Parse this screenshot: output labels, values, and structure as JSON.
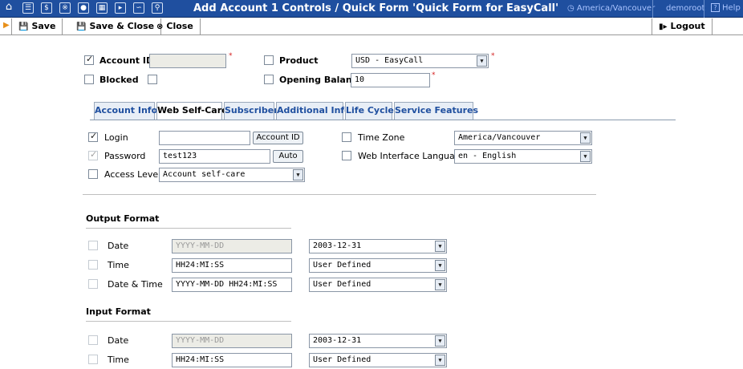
{
  "titlebar": {
    "icons": [
      "home-icon",
      "list-icon",
      "dollar-icon",
      "users-icon",
      "accounts-icon",
      "customers-icon",
      "forward-icon",
      "statistics-icon",
      "search-icon"
    ],
    "title": "Add Account 1 Controls / Quick Form 'Quick Form for EasyCall'",
    "timezone": "America/Vancouver",
    "user": "demoroot",
    "help": "Help"
  },
  "toolbar": {
    "save": "Save",
    "save_close": "Save & Close",
    "close": "Close",
    "logout": "Logout"
  },
  "header_fields": {
    "account_id": {
      "label": "Account ID",
      "checked": true,
      "value": ""
    },
    "blocked": {
      "label": "Blocked",
      "checked": false
    },
    "product": {
      "label": "Product",
      "checked": false,
      "value": "USD - EasyCall"
    },
    "opening_balance": {
      "label": "Opening Balance",
      "checked": false,
      "value": "10"
    }
  },
  "tabs": [
    {
      "label": "Account Info",
      "active": false
    },
    {
      "label": "Web Self-Care",
      "active": true
    },
    {
      "label": "Subscriber",
      "active": false
    },
    {
      "label": "Additional Info",
      "active": false
    },
    {
      "label": "Life Cycle",
      "active": false
    },
    {
      "label": "Service Features",
      "active": false
    }
  ],
  "web_self_care": {
    "login": {
      "label": "Login",
      "checked": true,
      "value": "",
      "button": "Account ID"
    },
    "password": {
      "label": "Password",
      "checked": true,
      "value": "test123",
      "button": "Auto"
    },
    "access_level": {
      "label": "Access Level",
      "checked": false,
      "value": "Account self-care"
    },
    "time_zone": {
      "label": "Time Zone",
      "checked": false,
      "value": "America/Vancouver"
    },
    "web_language": {
      "label": "Web Interface Language",
      "checked": false,
      "value": "en - English"
    }
  },
  "output_format": {
    "heading": "Output Format",
    "rows": [
      {
        "label": "Date",
        "value": "YYYY-MM-DD",
        "readonly": true,
        "select": "2003-12-31"
      },
      {
        "label": "Time",
        "value": "HH24:MI:SS",
        "readonly": false,
        "select": "User Defined"
      },
      {
        "label": "Date & Time",
        "value": "YYYY-MM-DD HH24:MI:SS",
        "readonly": false,
        "select": "User Defined"
      }
    ]
  },
  "input_format": {
    "heading": "Input Format",
    "rows": [
      {
        "label": "Date",
        "value": "YYYY-MM-DD",
        "readonly": true,
        "select": "2003-12-31"
      },
      {
        "label": "Time",
        "value": "HH24:MI:SS",
        "readonly": false,
        "select": "User Defined"
      }
    ]
  },
  "colors": {
    "titlebar_bg": "#1f4f9f",
    "link_blue": "#1f4f9f",
    "required": "#d42020",
    "toolbar_arrow": "#e8901a"
  }
}
